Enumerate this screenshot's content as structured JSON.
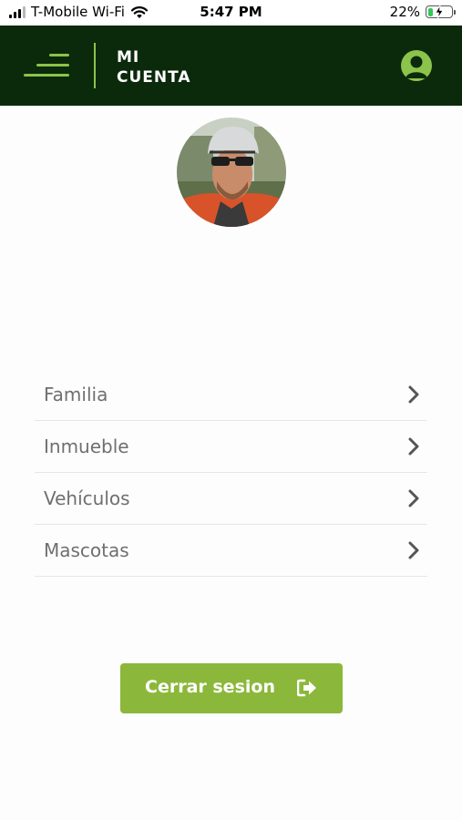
{
  "status_bar": {
    "carrier": "T-Mobile Wi-Fi",
    "time": "5:47 PM",
    "battery_percent": "22%",
    "battery_level": 0.22,
    "icons": [
      "signal-icon",
      "wifi-icon",
      "battery-charging-icon"
    ]
  },
  "header": {
    "title_line1": "MI",
    "title_line2": "CUENTA",
    "icons": [
      "menu-icon",
      "account-icon"
    ],
    "colors": {
      "background": "#0b2a0b",
      "accent": "#8cc34a",
      "title": "#ffffff"
    }
  },
  "profile": {
    "avatar": "profile-photo"
  },
  "menu": {
    "items": [
      {
        "label": "Familia",
        "icon": "chevron-right-icon"
      },
      {
        "label": "Inmueble",
        "icon": "chevron-right-icon"
      },
      {
        "label": "Vehículos",
        "icon": "chevron-right-icon"
      },
      {
        "label": "Mascotas",
        "icon": "chevron-right-icon"
      }
    ],
    "colors": {
      "label": "#6f6f6f",
      "divider": "#e6e6e6",
      "chevron": "#555555"
    }
  },
  "logout": {
    "label": "Cerrar sesion",
    "icon": "sign-out-icon",
    "color": "#8bb83a"
  }
}
